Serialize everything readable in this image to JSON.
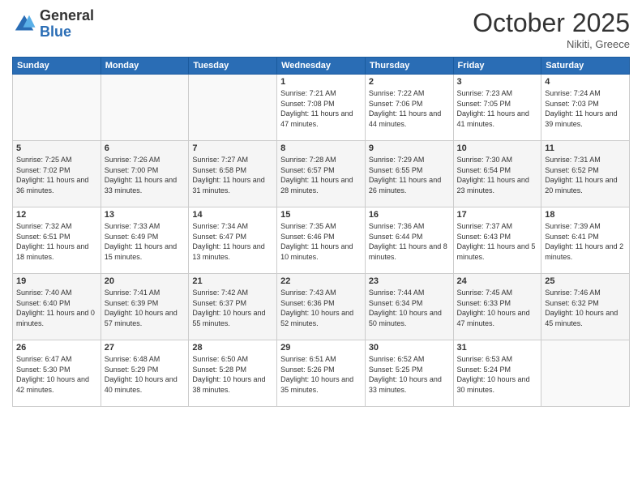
{
  "logo": {
    "general": "General",
    "blue": "Blue"
  },
  "title": "October 2025",
  "location": "Nikiti, Greece",
  "days_of_week": [
    "Sunday",
    "Monday",
    "Tuesday",
    "Wednesday",
    "Thursday",
    "Friday",
    "Saturday"
  ],
  "weeks": [
    [
      {
        "num": "",
        "info": ""
      },
      {
        "num": "",
        "info": ""
      },
      {
        "num": "",
        "info": ""
      },
      {
        "num": "1",
        "info": "Sunrise: 7:21 AM\nSunset: 7:08 PM\nDaylight: 11 hours and 47 minutes."
      },
      {
        "num": "2",
        "info": "Sunrise: 7:22 AM\nSunset: 7:06 PM\nDaylight: 11 hours and 44 minutes."
      },
      {
        "num": "3",
        "info": "Sunrise: 7:23 AM\nSunset: 7:05 PM\nDaylight: 11 hours and 41 minutes."
      },
      {
        "num": "4",
        "info": "Sunrise: 7:24 AM\nSunset: 7:03 PM\nDaylight: 11 hours and 39 minutes."
      }
    ],
    [
      {
        "num": "5",
        "info": "Sunrise: 7:25 AM\nSunset: 7:02 PM\nDaylight: 11 hours and 36 minutes."
      },
      {
        "num": "6",
        "info": "Sunrise: 7:26 AM\nSunset: 7:00 PM\nDaylight: 11 hours and 33 minutes."
      },
      {
        "num": "7",
        "info": "Sunrise: 7:27 AM\nSunset: 6:58 PM\nDaylight: 11 hours and 31 minutes."
      },
      {
        "num": "8",
        "info": "Sunrise: 7:28 AM\nSunset: 6:57 PM\nDaylight: 11 hours and 28 minutes."
      },
      {
        "num": "9",
        "info": "Sunrise: 7:29 AM\nSunset: 6:55 PM\nDaylight: 11 hours and 26 minutes."
      },
      {
        "num": "10",
        "info": "Sunrise: 7:30 AM\nSunset: 6:54 PM\nDaylight: 11 hours and 23 minutes."
      },
      {
        "num": "11",
        "info": "Sunrise: 7:31 AM\nSunset: 6:52 PM\nDaylight: 11 hours and 20 minutes."
      }
    ],
    [
      {
        "num": "12",
        "info": "Sunrise: 7:32 AM\nSunset: 6:51 PM\nDaylight: 11 hours and 18 minutes."
      },
      {
        "num": "13",
        "info": "Sunrise: 7:33 AM\nSunset: 6:49 PM\nDaylight: 11 hours and 15 minutes."
      },
      {
        "num": "14",
        "info": "Sunrise: 7:34 AM\nSunset: 6:47 PM\nDaylight: 11 hours and 13 minutes."
      },
      {
        "num": "15",
        "info": "Sunrise: 7:35 AM\nSunset: 6:46 PM\nDaylight: 11 hours and 10 minutes."
      },
      {
        "num": "16",
        "info": "Sunrise: 7:36 AM\nSunset: 6:44 PM\nDaylight: 11 hours and 8 minutes."
      },
      {
        "num": "17",
        "info": "Sunrise: 7:37 AM\nSunset: 6:43 PM\nDaylight: 11 hours and 5 minutes."
      },
      {
        "num": "18",
        "info": "Sunrise: 7:39 AM\nSunset: 6:41 PM\nDaylight: 11 hours and 2 minutes."
      }
    ],
    [
      {
        "num": "19",
        "info": "Sunrise: 7:40 AM\nSunset: 6:40 PM\nDaylight: 11 hours and 0 minutes."
      },
      {
        "num": "20",
        "info": "Sunrise: 7:41 AM\nSunset: 6:39 PM\nDaylight: 10 hours and 57 minutes."
      },
      {
        "num": "21",
        "info": "Sunrise: 7:42 AM\nSunset: 6:37 PM\nDaylight: 10 hours and 55 minutes."
      },
      {
        "num": "22",
        "info": "Sunrise: 7:43 AM\nSunset: 6:36 PM\nDaylight: 10 hours and 52 minutes."
      },
      {
        "num": "23",
        "info": "Sunrise: 7:44 AM\nSunset: 6:34 PM\nDaylight: 10 hours and 50 minutes."
      },
      {
        "num": "24",
        "info": "Sunrise: 7:45 AM\nSunset: 6:33 PM\nDaylight: 10 hours and 47 minutes."
      },
      {
        "num": "25",
        "info": "Sunrise: 7:46 AM\nSunset: 6:32 PM\nDaylight: 10 hours and 45 minutes."
      }
    ],
    [
      {
        "num": "26",
        "info": "Sunrise: 6:47 AM\nSunset: 5:30 PM\nDaylight: 10 hours and 42 minutes."
      },
      {
        "num": "27",
        "info": "Sunrise: 6:48 AM\nSunset: 5:29 PM\nDaylight: 10 hours and 40 minutes."
      },
      {
        "num": "28",
        "info": "Sunrise: 6:50 AM\nSunset: 5:28 PM\nDaylight: 10 hours and 38 minutes."
      },
      {
        "num": "29",
        "info": "Sunrise: 6:51 AM\nSunset: 5:26 PM\nDaylight: 10 hours and 35 minutes."
      },
      {
        "num": "30",
        "info": "Sunrise: 6:52 AM\nSunset: 5:25 PM\nDaylight: 10 hours and 33 minutes."
      },
      {
        "num": "31",
        "info": "Sunrise: 6:53 AM\nSunset: 5:24 PM\nDaylight: 10 hours and 30 minutes."
      },
      {
        "num": "",
        "info": ""
      }
    ]
  ]
}
